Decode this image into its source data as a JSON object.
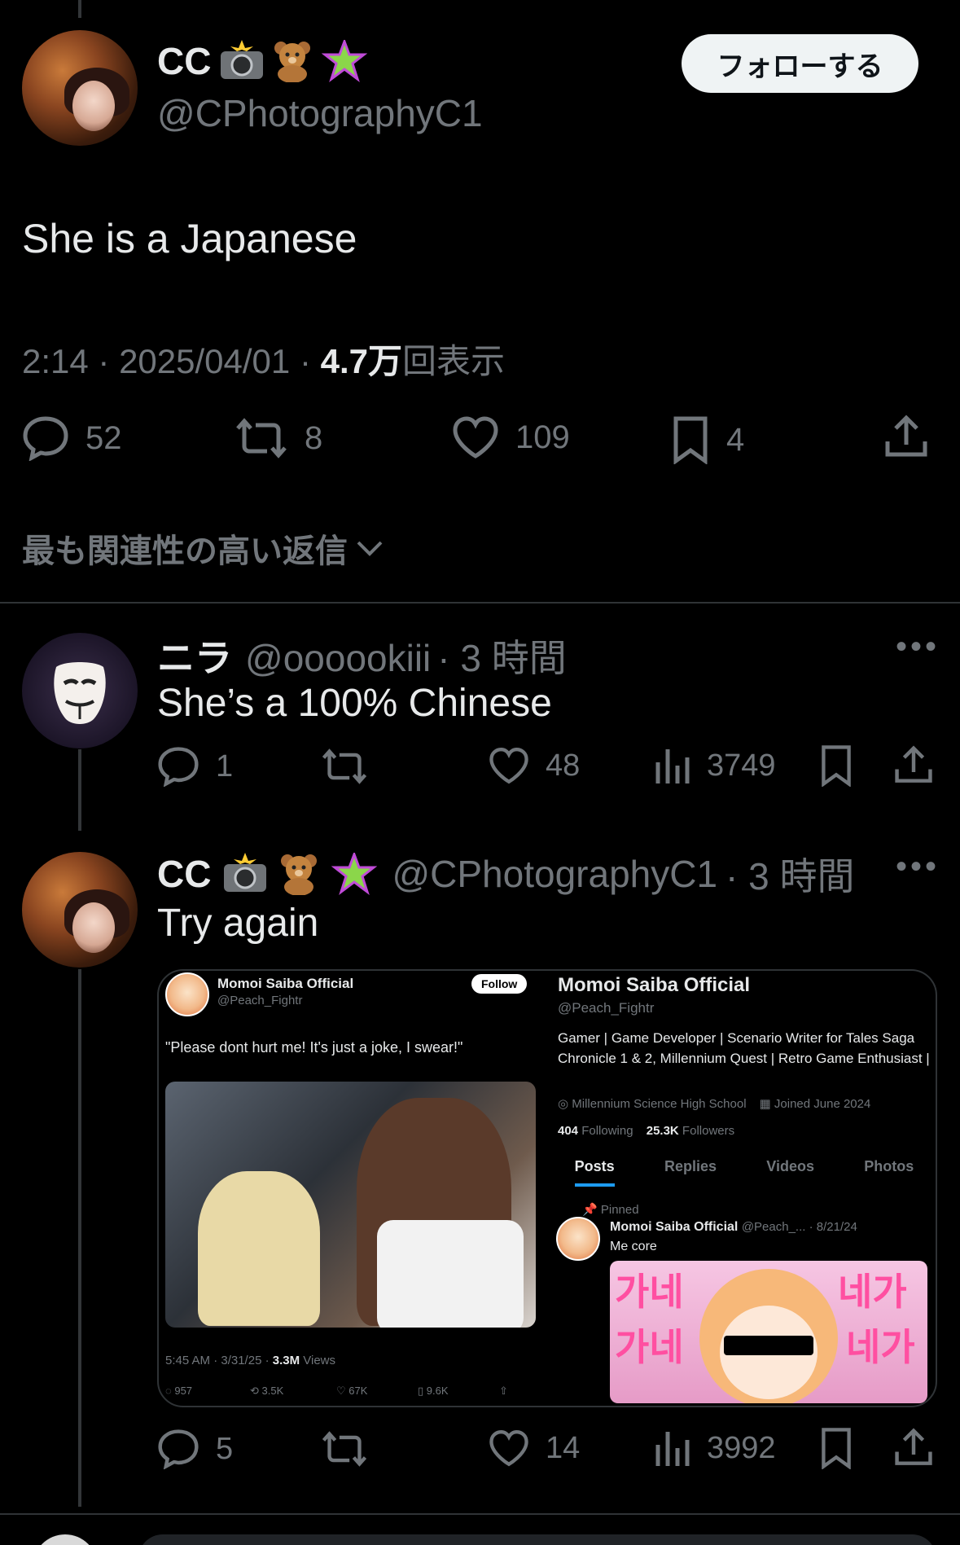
{
  "main_post": {
    "name": "CC",
    "handle": "@CPhotographyC1",
    "follow_label": "フォローする",
    "text": "She is a Japanese",
    "meta_time": "2:14 · 2025/04/01 · ",
    "meta_views_count": "4.7万",
    "meta_views_label": "回表示",
    "replies": "52",
    "reposts": "8",
    "likes": "109",
    "bookmarks": "4"
  },
  "sort_label": "最も関連性の高い返信",
  "reply1": {
    "name": "ニラ",
    "handle": "@oooookiii",
    "time": "· 3 時間",
    "text": "She’s a 100% Chinese",
    "replies": "1",
    "likes": "48",
    "views": "3749"
  },
  "reply2": {
    "name": "CC",
    "handle": "@CPhotographyC1",
    "time": "· 3 時間",
    "text": "Try again",
    "replies": "5",
    "likes": "14",
    "views": "3992"
  },
  "embed": {
    "left_name": "Momoi Saiba Official",
    "left_handle": "@Peach_Fightr",
    "left_follow": "Follow",
    "left_text": "\"Please dont hurt me! It's just a joke, I swear!\"",
    "left_meta_time": "5:45 AM · 3/31/25 · ",
    "left_meta_views_count": "3.3M",
    "left_meta_views_label": " Views",
    "left_stats": [
      "957",
      "3.5K",
      "67K",
      "9.6K"
    ],
    "right_name": "Momoi Saiba Official",
    "right_handle": "@Peach_Fightr",
    "right_bio": "Gamer | Game Developer | Scenario Writer for Tales Saga Chronicle 1 & 2, Millennium Quest | Retro Game Enthusiast |",
    "right_location": "Millennium Science High School",
    "right_joined": "Joined June 2024",
    "right_following_count": "404",
    "right_following_label": " Following",
    "right_followers_count": "25.3K",
    "right_followers_label": " Followers",
    "tabs": [
      "Posts",
      "Replies",
      "Videos",
      "Photos"
    ],
    "pinned": "Pinned",
    "pinned_name": "Momoi Saiba Official",
    "pinned_handle_date": "@Peach_... · 8/21/24",
    "pinned_text": "Me core"
  },
  "colors": {
    "background": "#000000",
    "text": "#e7e9ea",
    "muted": "#71767b",
    "accent": "#1d9bf0",
    "divider": "#2f3336"
  }
}
